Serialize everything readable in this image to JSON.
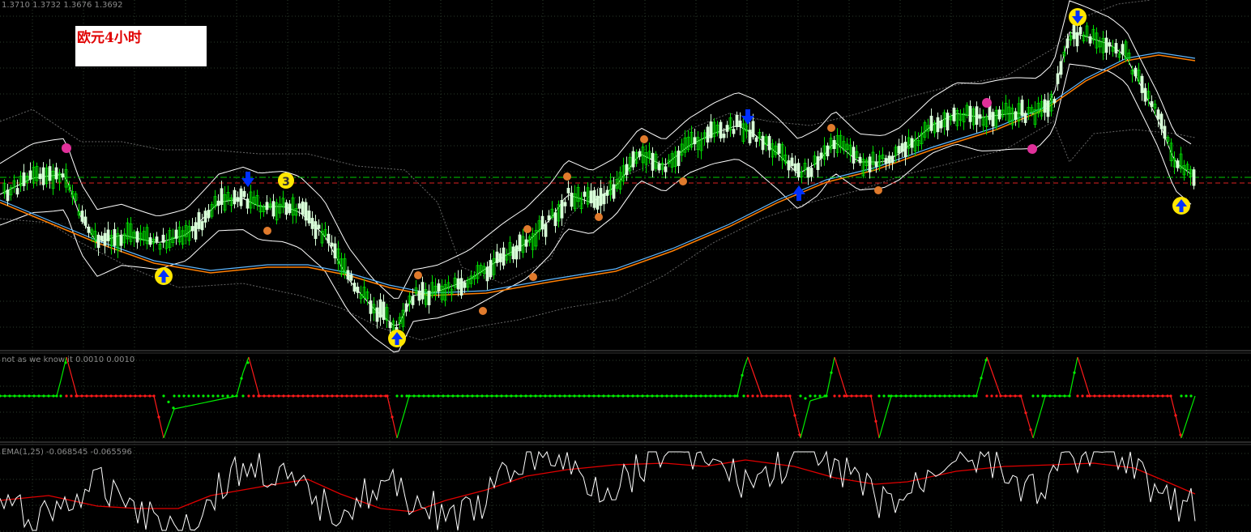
{
  "header": {
    "price_readout": "1.3710 1.3732 1.3676 1.3692",
    "title_label": "欧元4小时"
  },
  "indicator1": {
    "label": "not as we know it",
    "values_readout": "0.0010 0.0010"
  },
  "indicator2": {
    "label": "EMA(1,25)",
    "values_readout": "-0.068545 -0.065596"
  },
  "colors": {
    "background": "#000000",
    "grid": "#2b3b2b",
    "bull_candle": "#00dd00",
    "bear_candle": "#d8ffd8",
    "band": "#ffffff",
    "ma_orange": "#ff7f00",
    "ma_blue": "#5fb8ff",
    "step_up": "#00ee00",
    "step_down": "#ff1a1a",
    "osc_fast": "#ffffff",
    "osc_slow": "#e00000",
    "sell_arrow": "#0030ff",
    "signal_circle": "#ffe600",
    "dot_orange": "#e07a2c",
    "dot_magenta": "#e0309a"
  },
  "chart_data": [
    {
      "type": "candlestick",
      "title": "欧元4小时",
      "overlays": [
        "bollinger-bands",
        "moving-average-orange",
        "moving-average-blue",
        "envelope-dotted"
      ],
      "markers": [
        {
          "kind": "sell-arrow",
          "x_index": 78
        },
        {
          "kind": "buy-arrow-circle",
          "x_index": 51
        },
        {
          "kind": "label-circle",
          "x_index": 89,
          "text": "3"
        },
        {
          "kind": "buy-arrow-circle",
          "x_index": 125
        },
        {
          "kind": "sell-arrow",
          "x_index": 236
        },
        {
          "kind": "buy-arrow",
          "x_index": 253
        },
        {
          "kind": "sell-arrow-circle",
          "x_index": 341
        },
        {
          "kind": "buy-arrow-circle",
          "x_index": 374
        }
      ]
    },
    {
      "type": "line",
      "title": "not as we know it",
      "series": [
        {
          "name": "step-indicator"
        }
      ]
    },
    {
      "type": "line",
      "title": "EMA(1,25)",
      "series": [
        {
          "name": "fast"
        },
        {
          "name": "slow"
        }
      ]
    }
  ]
}
